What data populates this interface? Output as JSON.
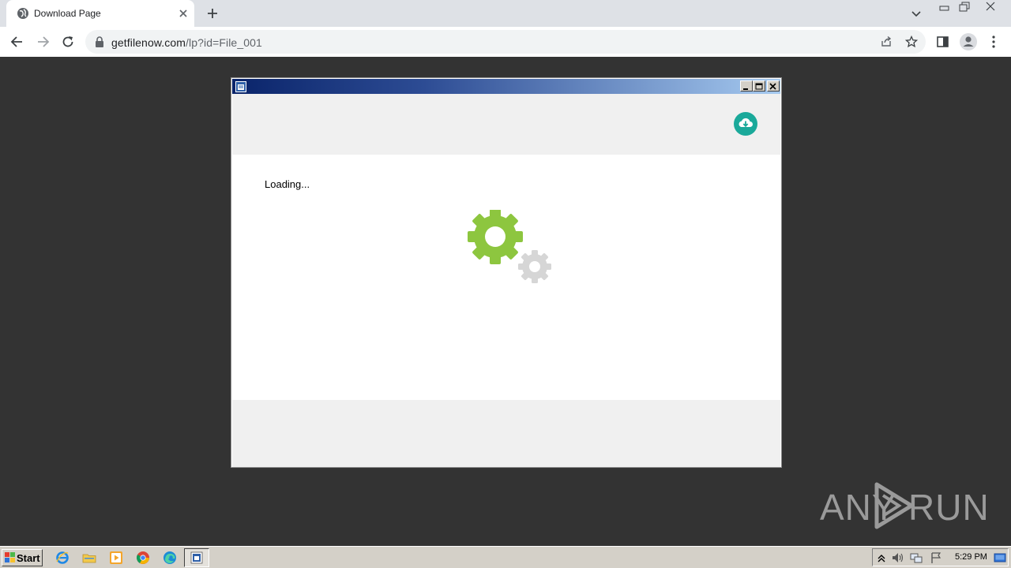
{
  "browser": {
    "tab": {
      "title": "Download Page"
    },
    "address": {
      "domain": "getfilenow.com",
      "path": "/lp?id=File_001"
    }
  },
  "app_window": {
    "loading_text": "Loading..."
  },
  "watermark": {
    "left": "ANY",
    "right": "RUN"
  },
  "taskbar": {
    "start_label": "Start",
    "clock": "5:29 PM"
  },
  "colors": {
    "accent_teal": "#1aa99a",
    "gear_green": "#8dc63f",
    "gear_gray": "#d6d6d6",
    "titlebar_start": "#0a246a",
    "titlebar_end": "#a6caf0"
  }
}
